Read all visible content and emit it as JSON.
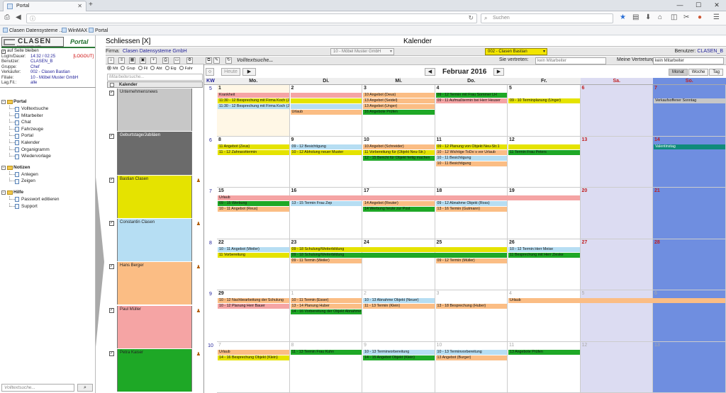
{
  "browser": {
    "tab_title": "Portal",
    "search_placeholder": "Suchen",
    "bookmarks": [
      "Clasen Datensysteme ...",
      "WinMAX",
      "Portal"
    ]
  },
  "left": {
    "stay_on_page": "auf Seite bleiben",
    "logout": "[LOGOUT]",
    "session": [
      {
        "label": "LogIn/Dauer:",
        "value": "14:32 / 02:25"
      },
      {
        "label": "Benutzer:",
        "value": "CLASEN_B"
      },
      {
        "label": "Gruppe:",
        "value": "Chef"
      },
      {
        "label": "Verkäufer:",
        "value": "002 - Clasen Bastian"
      },
      {
        "label": "Filiale:",
        "value": "10 - Möbel Muster GmbH"
      },
      {
        "label": "Lag.Fil.:",
        "value": "alle"
      }
    ],
    "nav": [
      {
        "group": "Portal",
        "items": [
          "Volltextsuche",
          "Mitarbeiter",
          "Chat",
          "Fahrzeuge",
          "Portal",
          "Kalender",
          "Organigramm",
          "Wiedervorlage"
        ]
      },
      {
        "group": "Notizen",
        "items": [
          "Anlegen",
          "Zeigen"
        ]
      },
      {
        "group": "Hilfe",
        "items": [
          "Passwort editieren",
          "Support"
        ]
      }
    ],
    "search_placeholder": "Volltextsuche..."
  },
  "header": {
    "close_label": "Schliessen [X]",
    "page_title": "Kalender",
    "firma_label": "Firma:",
    "firma_value": "Clasen Datensysteme GmbH",
    "filiale_select": "10 - Möbel Muster GmbH",
    "user_select": "002 - Clasen Bastian",
    "benutzer_label": "Benutzer:",
    "benutzer_value": "CLASEN_B"
  },
  "calendars": {
    "radio": [
      "Mit",
      "Grup",
      "Fil",
      "Abt",
      "Eig",
      "Fahr"
    ],
    "search_placeholder": "Mitarbeitersuche...",
    "header": "Kalender",
    "list": [
      {
        "name": "Unternehmensnews",
        "color": "#c7c7c7",
        "icon": ""
      },
      {
        "name": "Geburtstage/Jubiläen",
        "color": "#6b6b6b",
        "icon": ""
      },
      {
        "name": "Bastian Clasen",
        "color": "#e5e300",
        "icon": "person-icon"
      },
      {
        "name": "Constantin Clasen",
        "color": "#b6def3",
        "icon": "person-icon"
      },
      {
        "name": "Hans Berger",
        "color": "#fbbd84",
        "icon": "person-icon"
      },
      {
        "name": "Paul Müller",
        "color": "#f5a4a4",
        "icon": "person-icon"
      },
      {
        "name": "Petra Kaiser",
        "color": "#1ea826",
        "icon": "person-icon"
      }
    ]
  },
  "month": {
    "fulltext": "Volltextsuche...",
    "today": "Heute",
    "vertreten_label": "Sie vertreten:",
    "vertreten_value": "kein Mitarbeiter",
    "meine_label": "Meine Vertretung:",
    "meine_value": "kein Mitarbeiter",
    "title": "Februar 2016",
    "views": [
      "Monat",
      "Woche",
      "Tag"
    ],
    "columns": [
      "KW",
      "Mo.",
      "Di.",
      "Mi.",
      "Do.",
      "Fr.",
      "Sa.",
      "So."
    ],
    "weeks": [
      {
        "kw": "5",
        "days": [
          "1",
          "2",
          "3",
          "4",
          "5",
          "6",
          "7"
        ]
      },
      {
        "kw": "6",
        "days": [
          "8",
          "9",
          "10",
          "11",
          "12",
          "13",
          "14"
        ]
      },
      {
        "kw": "7",
        "days": [
          "15",
          "16",
          "17",
          "18",
          "19",
          "20",
          "21"
        ]
      },
      {
        "kw": "8",
        "days": [
          "22",
          "23",
          "24",
          "25",
          "26",
          "27",
          "28"
        ]
      },
      {
        "kw": "9",
        "days": [
          "29",
          "1",
          "2",
          "3",
          "4",
          "5",
          "6"
        ]
      },
      {
        "kw": "10",
        "days": [
          "7",
          "8",
          "9",
          "10",
          "11",
          "12",
          "13"
        ]
      }
    ],
    "events": [
      {
        "w": 0,
        "d": 0,
        "span": 1,
        "slot": 0,
        "c": "red",
        "t": "Krankheit"
      },
      {
        "w": 0,
        "d": 0,
        "span": 1,
        "slot": 1,
        "c": "yel",
        "t": "11:30 - 12 Besprechung mit Firma Koch (Jürgen Klein)"
      },
      {
        "w": 0,
        "d": 0,
        "span": 1,
        "slot": 2,
        "c": "blu",
        "t": "11:30 - 12 Besprechung mit Firma Koch (Jürgen Klein)"
      },
      {
        "w": 0,
        "d": 1,
        "span": 1,
        "slot": 3,
        "c": "ora",
        "t": "Urlaub"
      },
      {
        "w": 0,
        "d": 1,
        "span": 1,
        "slot": 0,
        "c": "red",
        "t": ""
      },
      {
        "w": 0,
        "d": 1,
        "span": 1,
        "slot": 1,
        "c": "yel",
        "t": ""
      },
      {
        "w": 0,
        "d": 1,
        "span": 1,
        "slot": 2,
        "c": "blu",
        "t": ""
      },
      {
        "w": 0,
        "d": 2,
        "span": 1,
        "slot": 0,
        "c": "ora",
        "t": "10 Angebot (Deus)"
      },
      {
        "w": 0,
        "d": 2,
        "span": 1,
        "slot": 1,
        "c": "ora",
        "t": "13 Angebot (Seidel)"
      },
      {
        "w": 0,
        "d": 2,
        "span": 1,
        "slot": 2,
        "c": "ora",
        "t": "13 Angebot (Unger)"
      },
      {
        "w": 0,
        "d": 2,
        "span": 1,
        "slot": 3,
        "c": "grn",
        "t": "16 Angebote Prüfen"
      },
      {
        "w": 0,
        "d": 3,
        "span": 1,
        "slot": 0,
        "c": "grn",
        "t": "09 - 12 Termin mit Frau Sommer LH"
      },
      {
        "w": 0,
        "d": 3,
        "span": 1,
        "slot": 1,
        "c": "red",
        "t": "09 - 11 Aufmaßtermin bei Herr Heuser"
      },
      {
        "w": 0,
        "d": 4,
        "span": 1,
        "slot": 1,
        "c": "yel",
        "t": "09 - 10 Terminplanung (Unger)"
      },
      {
        "w": 0,
        "d": 6,
        "span": 1,
        "slot": 1,
        "c": "gry",
        "t": "Verkaufsoffener Sonntag"
      },
      {
        "w": 1,
        "d": 0,
        "span": 1,
        "slot": 0,
        "c": "yel",
        "t": "11 Angebot (Zeus)"
      },
      {
        "w": 1,
        "d": 0,
        "span": 1,
        "slot": 1,
        "c": "yel",
        "t": "11 - 12 Zahnarzttermin"
      },
      {
        "w": 1,
        "d": 1,
        "span": 1,
        "slot": 0,
        "c": "blu",
        "t": "09 - 12 Besichtigung"
      },
      {
        "w": 1,
        "d": 1,
        "span": 1,
        "slot": 1,
        "c": "yel",
        "t": "10 - 12 Abholung neuer Muster"
      },
      {
        "w": 1,
        "d": 2,
        "span": 1,
        "slot": 0,
        "c": "ora",
        "t": "10 Angebot (Schneider)"
      },
      {
        "w": 1,
        "d": 2,
        "span": 1,
        "slot": 1,
        "c": "yel",
        "t": "11 Vorbereitung für (Objekt Neu-Str.)"
      },
      {
        "w": 1,
        "d": 2,
        "span": 1,
        "slot": 2,
        "c": "grn",
        "t": "12 - 15 Bericht für Objekt fertig machen"
      },
      {
        "w": 1,
        "d": 3,
        "span": 1,
        "slot": 0,
        "c": "yel",
        "t": "09 - 12 Planung von Objekt Neu-Str.1"
      },
      {
        "w": 1,
        "d": 3,
        "span": 1,
        "slot": 1,
        "c": "ora",
        "t": "10 - 12 Wichtige ToDo´s vor Urlaub"
      },
      {
        "w": 1,
        "d": 3,
        "span": 1,
        "slot": 2,
        "c": "blu",
        "t": "10 - 11 Besichtigung"
      },
      {
        "w": 1,
        "d": 3,
        "span": 1,
        "slot": 3,
        "c": "ora",
        "t": "10 - 11 Besichtigung"
      },
      {
        "w": 1,
        "d": 4,
        "span": 1,
        "slot": 0,
        "c": "yel",
        "t": ""
      },
      {
        "w": 1,
        "d": 4,
        "span": 1,
        "slot": 1,
        "c": "grn",
        "t": "11 Termin Frau Peters"
      },
      {
        "w": 1,
        "d": 6,
        "span": 1,
        "slot": 0,
        "c": "teal",
        "t": "Valentinstag"
      },
      {
        "w": 2,
        "d": 0,
        "span": 5,
        "slot": 0,
        "c": "red",
        "t": "Urlaub"
      },
      {
        "w": 2,
        "d": 0,
        "span": 1,
        "slot": 1,
        "c": "grn",
        "t": "09 - 15 Werbung"
      },
      {
        "w": 2,
        "d": 0,
        "span": 1,
        "slot": 2,
        "c": "ora",
        "t": "10 - 11 Angebot (Reus)"
      },
      {
        "w": 2,
        "d": 1,
        "span": 1,
        "slot": 1,
        "c": "blu",
        "t": "13 - 15 Termin Frau Zep"
      },
      {
        "w": 2,
        "d": 2,
        "span": 1,
        "slot": 1,
        "c": "ora",
        "t": "14 Angebot (Reuter)"
      },
      {
        "w": 2,
        "d": 2,
        "span": 1,
        "slot": 2,
        "c": "grn",
        "t": "14 Werbung heute zur Post"
      },
      {
        "w": 2,
        "d": 3,
        "span": 1,
        "slot": 1,
        "c": "blu",
        "t": "09 - 12 Abnahme Objekt (Ross)"
      },
      {
        "w": 2,
        "d": 3,
        "span": 1,
        "slot": 2,
        "c": "ora",
        "t": "13 - 16 Termin (Gutmann)"
      },
      {
        "w": 3,
        "d": 0,
        "span": 1,
        "slot": 0,
        "c": "blu",
        "t": "10 - 11 Angebot (Weiler)"
      },
      {
        "w": 3,
        "d": 0,
        "span": 1,
        "slot": 1,
        "c": "yel",
        "t": "11 Vorbereitung"
      },
      {
        "w": 3,
        "d": 1,
        "span": 3,
        "slot": 0,
        "c": "yel",
        "t": "09 - 18 Schulung/Weiterbildung"
      },
      {
        "w": 3,
        "d": 1,
        "span": 3,
        "slot": 1,
        "c": "grn",
        "t": "09 - 18 Schulung/Weiterbildung"
      },
      {
        "w": 3,
        "d": 1,
        "span": 1,
        "slot": 2,
        "c": "ora",
        "t": "09 - 11 Termin (Weiler)"
      },
      {
        "w": 3,
        "d": 3,
        "span": 1,
        "slot": 2,
        "c": "ora",
        "t": "09 - 12 Termin (Müller)"
      },
      {
        "w": 3,
        "d": 4,
        "span": 1,
        "slot": 0,
        "c": "blu",
        "t": "10 - 12 Termin Herr Meise"
      },
      {
        "w": 3,
        "d": 4,
        "span": 1,
        "slot": 1,
        "c": "grn",
        "t": "11 Besprechung mit Herr Zieske"
      },
      {
        "w": 4,
        "d": 0,
        "span": 1,
        "slot": 0,
        "c": "ora",
        "t": "10 - 12 Nachbearbeitung der Schulung"
      },
      {
        "w": 4,
        "d": 0,
        "span": 1,
        "slot": 1,
        "c": "red",
        "t": "10 - 12 Planung Herr Bauer"
      },
      {
        "w": 4,
        "d": 1,
        "span": 1,
        "slot": 0,
        "c": "ora",
        "t": "10 - 11 Termin (Esser)"
      },
      {
        "w": 4,
        "d": 1,
        "span": 1,
        "slot": 1,
        "c": "ora",
        "t": "13 - 14 Planung Huber"
      },
      {
        "w": 4,
        "d": 1,
        "span": 1,
        "slot": 2,
        "c": "grn",
        "t": "14 - 16 Vorbereitung der Objekt Abnahme"
      },
      {
        "w": 4,
        "d": 2,
        "span": 1,
        "slot": 0,
        "c": "blu",
        "t": "10 - 13 Abnahme Objekt (Neuer)"
      },
      {
        "w": 4,
        "d": 2,
        "span": 1,
        "slot": 1,
        "c": "ora",
        "t": "11 - 13 Termin (Klein)"
      },
      {
        "w": 4,
        "d": 3,
        "span": 1,
        "slot": 1,
        "c": "ora",
        "t": "13 - 18 Besprechung (Huber)"
      },
      {
        "w": 4,
        "d": 4,
        "span": 3,
        "slot": 0,
        "c": "ora",
        "t": "Urlaub"
      },
      {
        "w": 5,
        "d": 0,
        "span": 1,
        "slot": 0,
        "c": "ora",
        "t": "Urlaub"
      },
      {
        "w": 5,
        "d": 0,
        "span": 1,
        "slot": 1,
        "c": "yel",
        "t": "14 - 16 Besprechung Objekt (Klein)"
      },
      {
        "w": 5,
        "d": 1,
        "span": 1,
        "slot": 0,
        "c": "grn",
        "t": "11 - 13 Termin Frau Kuhn"
      },
      {
        "w": 5,
        "d": 2,
        "span": 1,
        "slot": 0,
        "c": "blu",
        "t": "10 - 13 Terminvorbereitung"
      },
      {
        "w": 5,
        "d": 2,
        "span": 1,
        "slot": 1,
        "c": "grn",
        "t": "14 - 15 Angebot Objekt (Klein)"
      },
      {
        "w": 5,
        "d": 3,
        "span": 1,
        "slot": 0,
        "c": "blu",
        "t": "10 - 13 Terminvorbereitung"
      },
      {
        "w": 5,
        "d": 3,
        "span": 1,
        "slot": 1,
        "c": "ora",
        "t": "13 Angebot (Burger)"
      },
      {
        "w": 5,
        "d": 4,
        "span": 1,
        "slot": 0,
        "c": "grn",
        "t": "13 Angebote Prüfen"
      }
    ]
  }
}
